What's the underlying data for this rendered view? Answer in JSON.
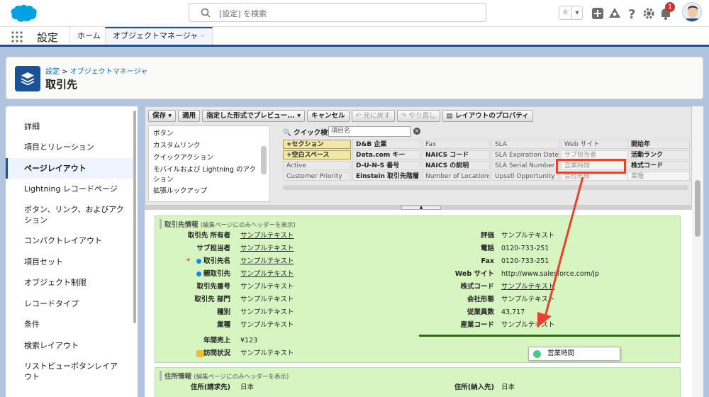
{
  "header": {
    "search_placeholder": "[設定] を検索",
    "notification_count": "1"
  },
  "nav": {
    "app_name": "設定",
    "tabs": [
      {
        "label": "ホーム"
      },
      {
        "label": "オブジェクトマネージャ"
      }
    ]
  },
  "page_header": {
    "breadcrumb_1": "設定",
    "breadcrumb_sep": ">",
    "breadcrumb_2": "オブジェクトマネージャ",
    "title": "取引先"
  },
  "sidebar": {
    "items": [
      {
        "label": "詳細"
      },
      {
        "label": "項目とリレーション"
      },
      {
        "label": "ページレイアウト"
      },
      {
        "label": "Lightning レコードページ"
      },
      {
        "label": "ボタン、リンク、およびアクション"
      },
      {
        "label": "コンパクトレイアウト"
      },
      {
        "label": "項目セット"
      },
      {
        "label": "オブジェクト制限"
      },
      {
        "label": "レコードタイプ"
      },
      {
        "label": "条件"
      },
      {
        "label": "検索レイアウト"
      },
      {
        "label": "リストビューボタンレイアウト"
      }
    ]
  },
  "toolbar": {
    "save": "保存 ▾",
    "quicksave": "適用",
    "preview": "指定した形式でプレビュー... ▾",
    "cancel": "キャンセル",
    "undo": "元に戻す",
    "redo": "やり直し",
    "props": "レイアウトのプロパティ"
  },
  "palette": {
    "categories": [
      {
        "label": "ボタン"
      },
      {
        "label": "カスタムリンク"
      },
      {
        "label": "クイックアクション"
      },
      {
        "label": "モバイルおよび Lightning のアクション"
      },
      {
        "label": "拡張ルックアップ"
      }
    ],
    "quickfind_label": "クイック検索",
    "quickfind_placeholder": "項目名",
    "fields": [
      [
        "セクション",
        "D&B 企業",
        "Fax",
        "SLA",
        "Web サイト",
        "開始年"
      ],
      [
        "空白スペース",
        "Data.com キー",
        "NAICS コード",
        "SLA Expiration Date",
        "サブ担当者",
        "活動ランク"
      ],
      [
        "Active",
        "D-U-N-S 番号",
        "NAICS の説明",
        "SLA Serial Number",
        "営業時間",
        "株式コード"
      ],
      [
        "Customer Priority",
        "Einstein 取引先階層",
        "Number of Locations",
        "Upsell Opportunity",
        "会社形態",
        "業種"
      ]
    ]
  },
  "section1": {
    "title": "取引先情報",
    "note": "(編集ページにのみヘッダーを表示)",
    "left": [
      {
        "label": "取引先 所有者",
        "value": "サンプルテキスト"
      },
      {
        "label": "サブ担当者",
        "value": "サンプルテキスト"
      },
      {
        "label": "取引先名",
        "value": "サンプルテキスト"
      },
      {
        "label": "親取引先",
        "value": "サンプルテキスト"
      },
      {
        "label": "取引先番号",
        "value": "サンプルテキスト"
      },
      {
        "label": "取引先 部門",
        "value": "サンプルテキスト"
      },
      {
        "label": "種別",
        "value": "サンプルテキスト"
      },
      {
        "label": "業種",
        "value": "サンプルテキスト"
      },
      {
        "label": "年間売上",
        "value": "¥123"
      },
      {
        "label": "訪問状況",
        "value": "サンプルテキスト"
      }
    ],
    "right": [
      {
        "label": "評価",
        "value": "サンプルテキスト"
      },
      {
        "label": "電話",
        "value": "0120-733-251"
      },
      {
        "label": "Fax",
        "value": "0120-733-251"
      },
      {
        "label": "Web サイト",
        "value": "http://www.salesforce.com/jp"
      },
      {
        "label": "株式コード",
        "value": "サンプルテキスト"
      },
      {
        "label": "会社形態",
        "value": "サンプルテキスト"
      },
      {
        "label": "従業員数",
        "value": "43,717"
      },
      {
        "label": "産業コード",
        "value": "サンプルテキスト"
      }
    ]
  },
  "drag_item": {
    "label": "営業時間"
  },
  "section2": {
    "title": "住所情報",
    "note": "(編集ページにのみヘッダーを表示)",
    "left": {
      "label": "住所(請求先)",
      "value": "日本"
    },
    "right": {
      "label": "住所(納入先)",
      "value": "日本"
    }
  },
  "colors": {
    "brand": "#1b5297",
    "section_bg": "#d6f5c1",
    "highlight": "#e8412d",
    "salesforce_blue": "#00a1e0"
  }
}
